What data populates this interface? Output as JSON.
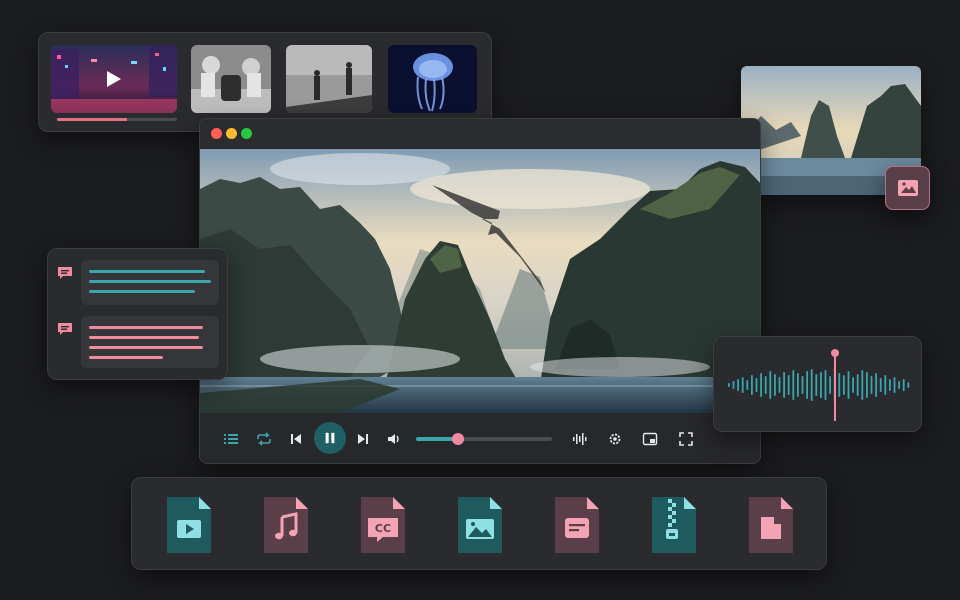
{
  "thumbnail_strip": {
    "items": [
      {
        "name": "neon-city",
        "active": true,
        "icon": "play-icon"
      },
      {
        "name": "robot-arms",
        "active": false
      },
      {
        "name": "silhouettes",
        "active": false
      },
      {
        "name": "jellyfish",
        "active": false
      }
    ],
    "progress": 0.58
  },
  "player": {
    "window_controls": [
      "close",
      "minimize",
      "maximize"
    ],
    "controls": [
      {
        "icon": "playlist-icon"
      },
      {
        "icon": "repeat-icon"
      },
      {
        "icon": "skip-previous-icon"
      },
      {
        "icon": "pause-icon"
      },
      {
        "icon": "skip-next-icon"
      },
      {
        "icon": "volume-icon"
      },
      {
        "icon": "audio-waveform-icon"
      },
      {
        "icon": "settings-gear-icon"
      },
      {
        "icon": "picture-in-picture-icon"
      },
      {
        "icon": "fullscreen-icon"
      }
    ],
    "seek_progress": 0.31,
    "state": "playing"
  },
  "file_types": [
    {
      "icon": "video-file-icon",
      "color": "#1f5a5e"
    },
    {
      "icon": "music-file-icon",
      "color": "#5a3e48"
    },
    {
      "icon": "subtitle-cc-file-icon",
      "color": "#5a3e48"
    },
    {
      "icon": "image-file-icon",
      "color": "#1f5a5e"
    },
    {
      "icon": "document-file-icon",
      "color": "#5a3e48"
    },
    {
      "icon": "zip-archive-file-icon",
      "color": "#1f5a5e"
    },
    {
      "icon": "blank-file-icon",
      "color": "#5a3e48"
    }
  ],
  "colors": {
    "teal": "#3aa6ae",
    "pink": "#f08aa0",
    "panel": "#2a2b2e",
    "background": "#1b1c1e"
  }
}
